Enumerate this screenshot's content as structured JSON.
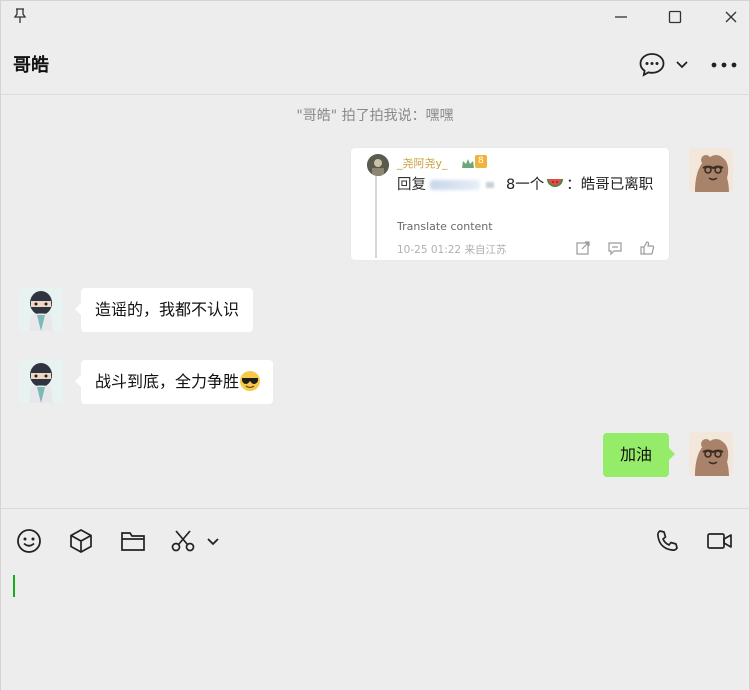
{
  "window": {
    "pin_icon": "pin-icon",
    "controls": [
      "minimize-icon",
      "maximize-icon",
      "close-icon"
    ]
  },
  "header": {
    "title": "哥皓",
    "chat_icon": "chat-bubble-icon",
    "dropdown_icon": "chevron-down-icon",
    "more_icon": "more-horizontal-icon"
  },
  "messages": {
    "system": "\"哥皓\" 拍了拍我说：嘿嘿",
    "quote_card": {
      "author": "_尧阿尧y_",
      "badge": "8",
      "reply_prefix": "回复",
      "reply_mid": "",
      "reply_frag": "8一个",
      "reply_tail": "：皓哥已离职",
      "translate": "Translate content",
      "meta": "10-25 01:22  来自江苏"
    },
    "incoming": [
      {
        "text": "造谣的，我都不认识"
      },
      {
        "text": "战斗到底，全力争胜"
      }
    ],
    "outgoing": [
      {
        "text": "加油"
      }
    ]
  },
  "composer": {
    "tools": [
      "emoji-icon",
      "box-icon",
      "folder-icon",
      "scissors-icon",
      "chevron-down-icon"
    ],
    "right_tools": [
      "phone-icon",
      "video-icon"
    ],
    "input_value": ""
  },
  "colors": {
    "background": "#ededed",
    "outgoing_bubble": "#95ec69",
    "incoming_bubble": "#ffffff",
    "caret": "#1aad19",
    "author": "#c9a03a"
  }
}
